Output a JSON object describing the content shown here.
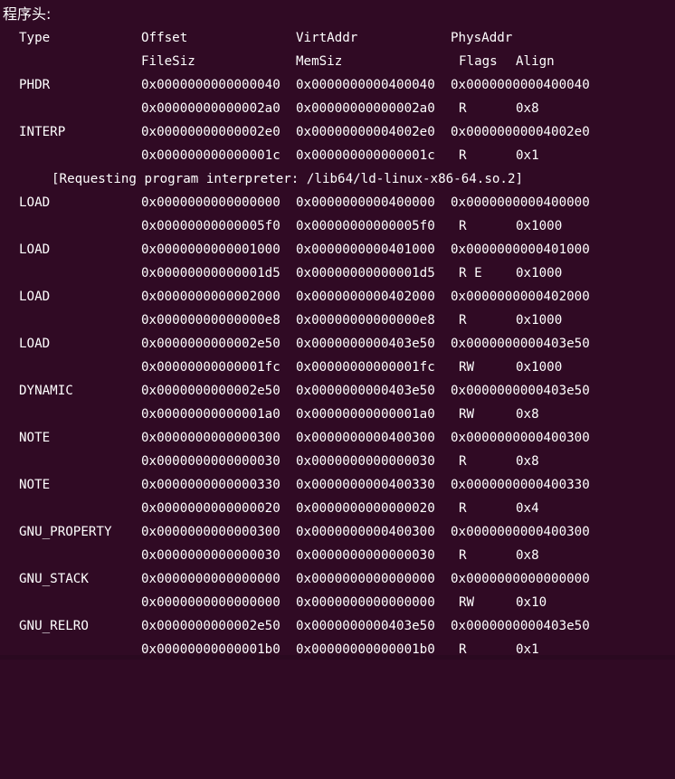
{
  "title": "程序头:",
  "headers": {
    "type": "Type",
    "offset": "Offset",
    "virtaddr": "VirtAddr",
    "physaddr": "PhysAddr",
    "filesiz": "FileSiz",
    "memsiz": "MemSiz",
    "flags": "Flags",
    "align": "Align"
  },
  "interp_note": "[Requesting program interpreter: /lib64/ld-linux-x86-64.so.2]",
  "rows": [
    {
      "type": "PHDR",
      "offset": "0x0000000000000040",
      "virtaddr": "0x0000000000400040",
      "physaddr": "0x0000000000400040",
      "filesiz": "0x00000000000002a0",
      "memsiz": "0x00000000000002a0",
      "flags": "R",
      "align": "0x8"
    },
    {
      "type": "INTERP",
      "offset": "0x00000000000002e0",
      "virtaddr": "0x00000000004002e0",
      "physaddr": "0x00000000004002e0",
      "filesiz": "0x000000000000001c",
      "memsiz": "0x000000000000001c",
      "flags": "R",
      "align": "0x1"
    },
    {
      "type": "LOAD",
      "offset": "0x0000000000000000",
      "virtaddr": "0x0000000000400000",
      "physaddr": "0x0000000000400000",
      "filesiz": "0x00000000000005f0",
      "memsiz": "0x00000000000005f0",
      "flags": "R",
      "align": "0x1000"
    },
    {
      "type": "LOAD",
      "offset": "0x0000000000001000",
      "virtaddr": "0x0000000000401000",
      "physaddr": "0x0000000000401000",
      "filesiz": "0x00000000000001d5",
      "memsiz": "0x00000000000001d5",
      "flags": "R E",
      "align": "0x1000"
    },
    {
      "type": "LOAD",
      "offset": "0x0000000000002000",
      "virtaddr": "0x0000000000402000",
      "physaddr": "0x0000000000402000",
      "filesiz": "0x00000000000000e8",
      "memsiz": "0x00000000000000e8",
      "flags": "R",
      "align": "0x1000"
    },
    {
      "type": "LOAD",
      "offset": "0x0000000000002e50",
      "virtaddr": "0x0000000000403e50",
      "physaddr": "0x0000000000403e50",
      "filesiz": "0x00000000000001fc",
      "memsiz": "0x00000000000001fc",
      "flags": "RW",
      "align": "0x1000"
    },
    {
      "type": "DYNAMIC",
      "offset": "0x0000000000002e50",
      "virtaddr": "0x0000000000403e50",
      "physaddr": "0x0000000000403e50",
      "filesiz": "0x00000000000001a0",
      "memsiz": "0x00000000000001a0",
      "flags": "RW",
      "align": "0x8"
    },
    {
      "type": "NOTE",
      "offset": "0x0000000000000300",
      "virtaddr": "0x0000000000400300",
      "physaddr": "0x0000000000400300",
      "filesiz": "0x0000000000000030",
      "memsiz": "0x0000000000000030",
      "flags": "R",
      "align": "0x8"
    },
    {
      "type": "NOTE",
      "offset": "0x0000000000000330",
      "virtaddr": "0x0000000000400330",
      "physaddr": "0x0000000000400330",
      "filesiz": "0x0000000000000020",
      "memsiz": "0x0000000000000020",
      "flags": "R",
      "align": "0x4"
    },
    {
      "type": "GNU_PROPERTY",
      "offset": "0x0000000000000300",
      "virtaddr": "0x0000000000400300",
      "physaddr": "0x0000000000400300",
      "filesiz": "0x0000000000000030",
      "memsiz": "0x0000000000000030",
      "flags": "R",
      "align": "0x8"
    },
    {
      "type": "GNU_STACK",
      "offset": "0x0000000000000000",
      "virtaddr": "0x0000000000000000",
      "physaddr": "0x0000000000000000",
      "filesiz": "0x0000000000000000",
      "memsiz": "0x0000000000000000",
      "flags": "RW",
      "align": "0x10"
    },
    {
      "type": "GNU_RELRO",
      "offset": "0x0000000000002e50",
      "virtaddr": "0x0000000000403e50",
      "physaddr": "0x0000000000403e50",
      "filesiz": "0x00000000000001b0",
      "memsiz": "0x00000000000001b0",
      "flags": "R",
      "align": "0x1"
    }
  ],
  "colors": {
    "background": "#300a24",
    "text": "#ffffff"
  }
}
